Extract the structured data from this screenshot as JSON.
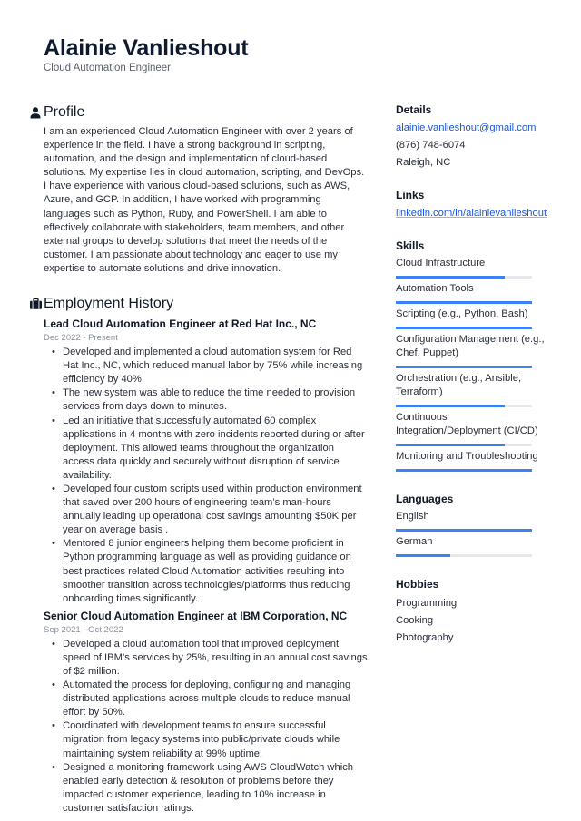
{
  "header": {
    "name": "Alainie Vanlieshout",
    "role": "Cloud Automation Engineer"
  },
  "profile": {
    "title": "Profile",
    "icon": "person-icon",
    "text": "I am an experienced Cloud Automation Engineer with over 2 years of experience in the field. I have a strong background in scripting, automation, and the design and implementation of cloud-based solutions. My expertise lies in cloud automation, scripting, and DevOps. I have experience with various cloud-based solutions, such as AWS, Azure, and GCP. In addition, I have worked with programming languages such as Python, Ruby, and PowerShell. I am able to effectively collaborate with stakeholders, team members, and other external groups to develop solutions that meet the needs of the customer. I am passionate about technology and eager to use my expertise to automate solutions and drive innovation."
  },
  "employment": {
    "title": "Employment History",
    "icon": "briefcase-icon",
    "jobs": [
      {
        "title": "Lead Cloud Automation Engineer at Red Hat Inc., NC",
        "dates": "Dec 2022 - Present",
        "bullets": [
          "Developed and implemented a cloud automation system for Red Hat Inc., NC, which reduced manual labor by 75% while increasing efficiency by 40%.",
          "The new system was able to reduce the time needed to provision services from days down to minutes.",
          "Led an initiative that successfully automated 60 complex applications in 4 months with zero incidents reported during or after deployment. This allowed teams throughout the organization access data quickly and securely without disruption of service availability.",
          "Developed four custom scripts used within production environment that saved over 200 hours of engineering team’s man-hours annually leading up operational cost savings amounting $50K per year on average basis .",
          "Mentored 8 junior engineers helping them become proficient in Python programming language as well as providing guidance on best practices related Cloud Automation activities resulting into smoother transition across technologies/platforms thus reducing onboarding times significantly."
        ]
      },
      {
        "title": "Senior Cloud Automation Engineer at IBM Corporation, NC",
        "dates": "Sep 2021 - Oct 2022",
        "bullets": [
          "Developed a cloud automation tool that improved deployment speed of IBM’s services by 25%, resulting in an annual cost savings of $2 million.",
          "Automated the process for deploying, configuring and managing distributed applications across multiple clouds to reduce manual effort by 50%.",
          "Coordinated with development teams to ensure successful migration from legacy systems into public/private clouds while maintaining system reliability at 99% uptime.",
          "Designed a monitoring framework using AWS CloudWatch which enabled early detection & resolution of problems before they impacted customer experience, leading to 10% increase in customer satisfaction ratings."
        ]
      }
    ]
  },
  "sidebar": {
    "details": {
      "title": "Details",
      "email": "alainie.vanlieshout@gmail.com",
      "phone": "(876) 748-6074",
      "location": "Raleigh, NC"
    },
    "links": {
      "title": "Links",
      "items": [
        "linkedin.com/in/alainievanlieshout"
      ]
    },
    "skills": {
      "title": "Skills",
      "items": [
        {
          "label": "Cloud Infrastructure",
          "level": 0.8
        },
        {
          "label": "Automation Tools",
          "level": 1.0
        },
        {
          "label": "Scripting (e.g., Python, Bash)",
          "level": 1.0
        },
        {
          "label": "Configuration Management (e.g., Chef, Puppet)",
          "level": 1.0
        },
        {
          "label": "Orchestration (e.g., Ansible, Terraform)",
          "level": 0.8
        },
        {
          "label": "Continuous Integration/Deployment (CI/CD)",
          "level": 0.8
        },
        {
          "label": "Monitoring and Troubleshooting",
          "level": 1.0
        }
      ]
    },
    "languages": {
      "title": "Languages",
      "items": [
        {
          "label": "English",
          "level": 1.0
        },
        {
          "label": "German",
          "level": 0.4
        }
      ]
    },
    "hobbies": {
      "title": "Hobbies",
      "items": [
        "Programming",
        "Cooking",
        "Photography"
      ]
    }
  },
  "colors": {
    "accent": "#3b82f6",
    "link": "#1a56db",
    "track": "#e6e8ec"
  }
}
